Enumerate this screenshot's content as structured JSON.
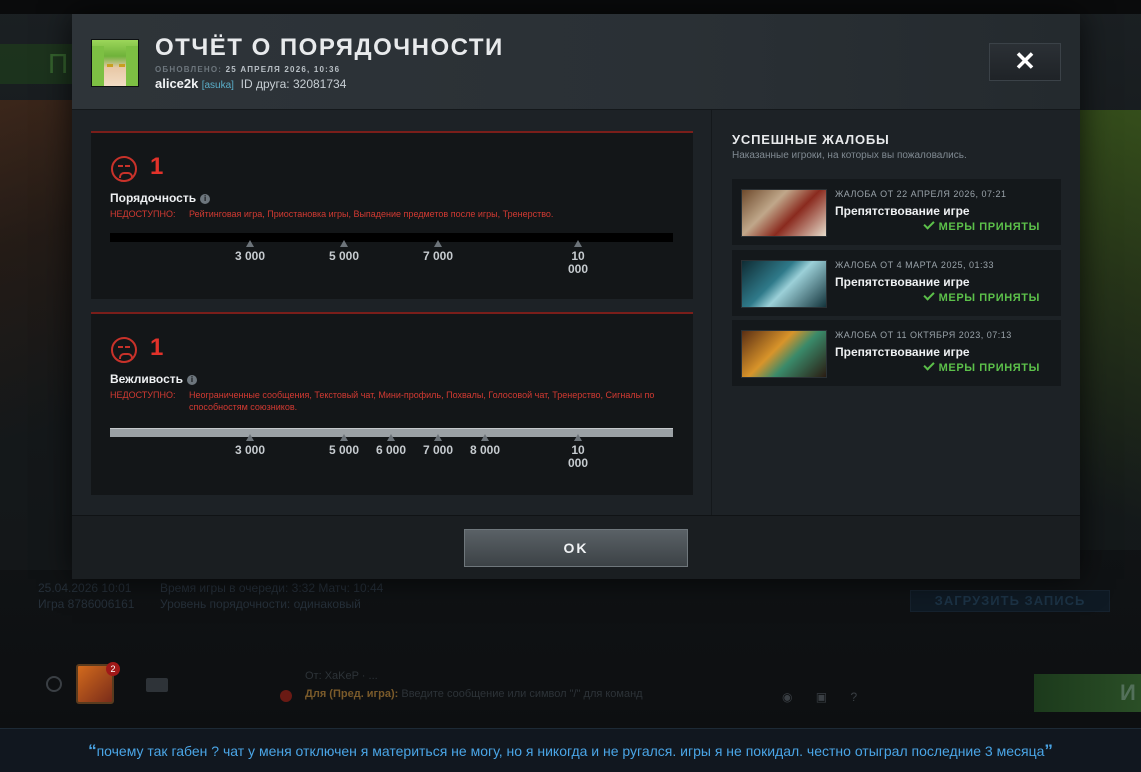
{
  "background": {
    "left_heading_fragment": "П",
    "meta_date": "25.04.2026 10:01",
    "meta_game_id": "Игра 8786006161",
    "meta_line_1": "Время игры в очереди: 3:32  Матч: 10:44",
    "meta_line_2": "Уровень порядочности: одинаковый",
    "load_record_label": "ЗАГРУЗИТЬ ЗАПИСЬ",
    "notification_count": "2",
    "chat_from": "От: XaKeP · ...",
    "chat_channel": "Для (Пред. игра):",
    "chat_placeholder": "Введите сообщение или символ \"/\" для команд",
    "play_button_fragment": "И"
  },
  "modal": {
    "title": "ОТЧЁТ О ПОРЯДОЧНОСТИ",
    "updated_label": "ОБНОВЛЕНО:",
    "updated_date": "25 АПРЕЛЯ 2026, 10:36",
    "username": "alice2k",
    "user_tag": "[asuka]",
    "friend_id": "ID друга: 32081734",
    "close_label": "✕",
    "ok_label": "OK"
  },
  "metrics": [
    {
      "score": "1",
      "name": "Порядочность",
      "unavailable_label": "НЕДОСТУПНО:",
      "unavailable_text": "Рейтинговая игра, Приостановка игры, Выпадение предметов после игры, Тренерство.",
      "bar_color": "#000000",
      "ticks": [
        "3 000",
        "5 000",
        "7 000",
        "10 000"
      ]
    },
    {
      "score": "1",
      "name": "Вежливость",
      "unavailable_label": "НЕДОСТУПНО:",
      "unavailable_text": "Неограниченные сообщения, Текстовый чат, Мини-профиль, Похвалы, Голосовой чат, Тренерство, Сигналы по способностям союзников.",
      "bar_color": "#9ba1a5",
      "ticks": [
        "3 000",
        "5 000",
        "6 000",
        "7 000",
        "8 000",
        "10 000"
      ]
    }
  ],
  "reports": {
    "title": "УСПЕШНЫЕ ЖАЛОБЫ",
    "subtitle": "Наказанные игроки, на которых вы пожаловались.",
    "items": [
      {
        "date": "ЖАЛОБА ОТ 22 АПРЕЛЯ 2026, 07:21",
        "reason": "Препятствование игре",
        "status": "МЕРЫ ПРИНЯТЫ"
      },
      {
        "date": "ЖАЛОБА ОТ 4 МАРТА 2025, 01:33",
        "reason": "Препятствование игре",
        "status": "МЕРЫ ПРИНЯТЫ"
      },
      {
        "date": "ЖАЛОБА ОТ 11 ОКТЯБРЯ 2023, 07:13",
        "reason": "Препятствование игре",
        "status": "МЕРЫ ПРИНЯТЫ"
      }
    ]
  },
  "caption": {
    "open_quote": "“",
    "text": "почему так габен ? чат у меня отключен я материться не могу, но я никогда и не ругался. игры я не покидал. честно отыграл последние 3 месяца",
    "close_quote": "”"
  },
  "colors": {
    "accent_red": "#e2322a",
    "status_green": "#5cc04a",
    "caption_blue": "#4aa5e6"
  }
}
